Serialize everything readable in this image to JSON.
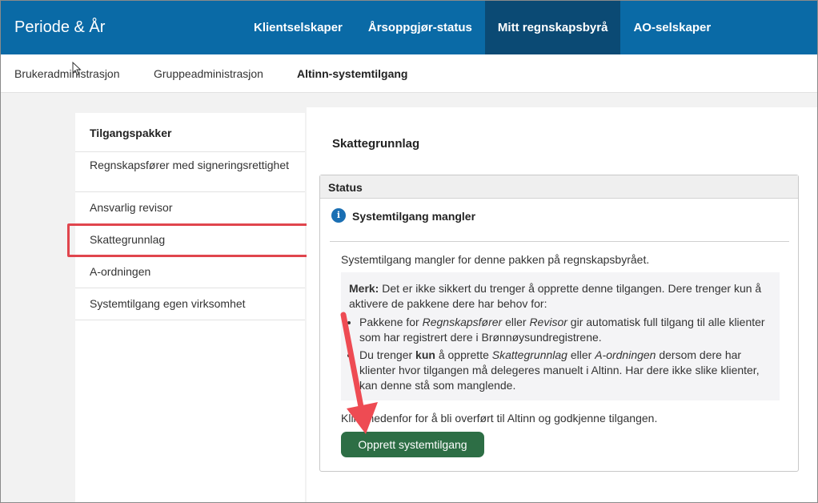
{
  "header": {
    "brand": "Periode & År",
    "nav": [
      {
        "label": "Klientselskaper",
        "active": false
      },
      {
        "label": "Årsoppgjør-status",
        "active": false
      },
      {
        "label": "Mitt regnskapsbyrå",
        "active": true
      },
      {
        "label": "AO-selskaper",
        "active": false
      }
    ]
  },
  "subnav": {
    "items": [
      {
        "label": "Brukeradministrasjon",
        "active": false
      },
      {
        "label": "Gruppeadministrasjon",
        "active": false
      },
      {
        "label": "Altinn-systemtilgang",
        "active": true
      }
    ]
  },
  "sidebar": {
    "title": "Tilgangspakker",
    "items": [
      {
        "label": "Regnskapsfører med signeringsrettighet"
      },
      {
        "label": "Ansvarlig revisor"
      },
      {
        "label": "Skattegrunnlag",
        "selected": true
      },
      {
        "label": "A-ordningen"
      },
      {
        "label": "Systemtilgang egen virksomhet"
      }
    ]
  },
  "main": {
    "title": "Skattegrunnlag",
    "status": {
      "header": "Status",
      "message": "Systemtilgang mangler",
      "description": "Systemtilgang mangler for denne pakken på regnskapsbyrået.",
      "note": {
        "label": "Merk:",
        "intro": "Det er ikke sikkert du trenger å opprette denne tilgangen. Dere trenger kun å aktivere de pakkene dere har behov for:",
        "b1": {
          "t1": "Pakkene for ",
          "e1": "Regnskapsfører",
          "t2": " eller ",
          "e2": "Revisor",
          "t3": " gir automatisk full tilgang til alle klienter som har registrert dere i Brønnøysundregistrene."
        },
        "b2": {
          "t1": "Du trenger ",
          "k": "kun",
          "t2": " å opprette ",
          "e1": "Skattegrunnlag",
          "t3": " eller ",
          "e2": "A-ordningen",
          "t4": " dersom dere har klienter hvor tilgangen må delegeres manuelt i Altinn. Har dere ikke slike klienter, kan denne stå som manglende."
        }
      },
      "instruction": "Klikk nedenfor for å bli overført til Altinn og godkjenne tilgangen.",
      "button": "Opprett systemtilgang"
    }
  },
  "colors": {
    "header_bg": "#0a6aa6",
    "active_nav_bg": "#0b4a74",
    "button_bg": "#2d6e45",
    "annotation": "#e0454d"
  },
  "icons": {
    "status": "info-icon",
    "cursor": "mouse-pointer-icon",
    "annotation": "arrow-annotation"
  }
}
